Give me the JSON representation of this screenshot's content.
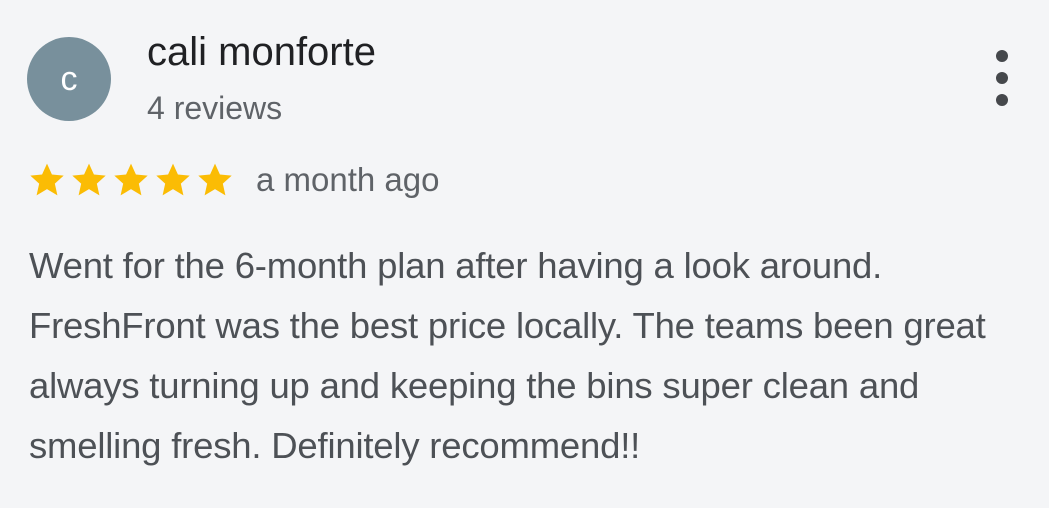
{
  "review": {
    "author": {
      "initial": "c",
      "name": "cali monforte",
      "review_count": "4 reviews"
    },
    "rating": 5,
    "rating_max": 5,
    "time_ago": "a month ago",
    "text": "Went for the 6-month plan after having a look around. FreshFront was the best price locally. The teams been great always turning up and keeping the bins super clean and smelling fresh. Definitely recommend!!"
  },
  "icons": {
    "star": "star-icon",
    "menu": "more-vert-icon"
  },
  "colors": {
    "star": "#fbbc04",
    "avatar_bg": "#78909c",
    "background": "#f4f5f7"
  }
}
